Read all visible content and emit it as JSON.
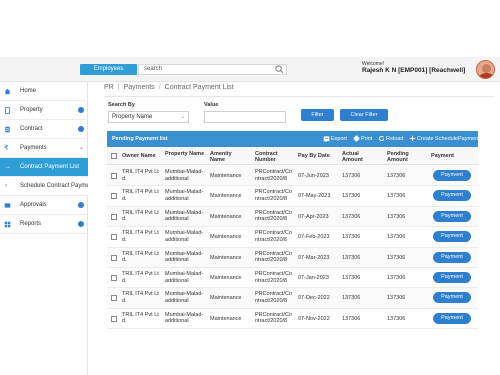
{
  "header": {
    "scope_label": "Employees",
    "search_placeholder": "search",
    "welcome": "Welcome!",
    "user": "Rajesh K N [EMP001] [Reachwell]"
  },
  "sidebar": {
    "items": [
      {
        "label": "Home",
        "icon": "home-icon"
      },
      {
        "label": "Property",
        "icon": "building-icon"
      },
      {
        "label": "Contract",
        "icon": "document-icon"
      },
      {
        "label": "Payments",
        "icon": "rupee-icon"
      },
      {
        "label": "Contract Payment List",
        "icon": "arrow-right-icon"
      },
      {
        "label": "Schedule Contract Payment",
        "icon": "chevron-right-icon"
      },
      {
        "label": "Approvals",
        "icon": "approval-icon"
      },
      {
        "label": "Reports",
        "icon": "grid-icon"
      }
    ]
  },
  "breadcrumb": {
    "root": "PR",
    "section": "Payments",
    "page": "Contract Payment List"
  },
  "filter": {
    "search_by_label": "Search By",
    "value_label": "Value",
    "selected_option": "Property Name",
    "filter_button": "Filter",
    "clear_button": "Clear Filter"
  },
  "panel": {
    "title": "Pending Payment list",
    "export": "Export",
    "print": "Print",
    "reload": "Reload",
    "create": "Create SchedulePayment"
  },
  "table": {
    "columns": [
      "Owner Name",
      "Property Name",
      "Amenity Name",
      "Contract Number",
      "Pay By Date",
      "Actual Amount",
      "Pending Amount",
      "Payment"
    ],
    "rows": [
      {
        "owner": "TRIL IT4 Pvt Lt d.",
        "property": "Mumbai-Malad-additional",
        "amenity": "Maintenance",
        "contract": "PRContract/Co ntract/2020/8",
        "date": "07-Jun-2023",
        "actual": "137306",
        "pending": "137306",
        "action": "Payment"
      },
      {
        "owner": "TRIL IT4 Pvt Lt d.",
        "property": "Mumbai-Malad-additional",
        "amenity": "Maintenance",
        "contract": "PRContract/Co ntract/2020/8",
        "date": "07-May-2023",
        "actual": "137306",
        "pending": "137306",
        "action": "Payment"
      },
      {
        "owner": "TRIL IT4 Pvt Lt d.",
        "property": "Mumbai-Malad-additional",
        "amenity": "Maintenance",
        "contract": "PRContract/Co ntract/2020/8",
        "date": "07-Apr-2023",
        "actual": "137306",
        "pending": "137306",
        "action": "Payment"
      },
      {
        "owner": "TRIL IT4 Pvt Lt d.",
        "property": "Mumbai-Malad-additional",
        "amenity": "Maintenance",
        "contract": "PRContract/Co ntract/2020/8",
        "date": "07-Feb-2023",
        "actual": "137306",
        "pending": "137306",
        "action": "Payment"
      },
      {
        "owner": "TRIL IT4 Pvt Lt d.",
        "property": "Mumbai-Malad-additional",
        "amenity": "Maintenance",
        "contract": "PRContract/Co ntract/2020/8",
        "date": "07-Mar-2023",
        "actual": "137306",
        "pending": "137306",
        "action": "Payment"
      },
      {
        "owner": "TRIL IT4 Pvt Lt d.",
        "property": "Mumbai-Malad-additional",
        "amenity": "Maintenance",
        "contract": "PRContract/Co ntract/2020/8",
        "date": "07-Jan-2023",
        "actual": "137306",
        "pending": "137306",
        "action": "Payment"
      },
      {
        "owner": "TRIL IT4 Pvt Lt d.",
        "property": "Mumbai-Malad-additional",
        "amenity": "Maintenance",
        "contract": "PRContract/Co ntract/2020/8",
        "date": "07-Dec-2022",
        "actual": "137306",
        "pending": "137306",
        "action": "Payment"
      },
      {
        "owner": "TRIL IT4 Pvt Lt d.",
        "property": "Mumbai-Malad-additional",
        "amenity": "Maintenance",
        "contract": "PRContract/Co ntract/2020/8",
        "date": "07-Nov-2022",
        "actual": "137306",
        "pending": "137306",
        "action": "Payment"
      }
    ]
  },
  "colors": {
    "accent": "#2f9ed6",
    "button": "#2f7fcf",
    "panel_header": "#3a8fd0"
  }
}
